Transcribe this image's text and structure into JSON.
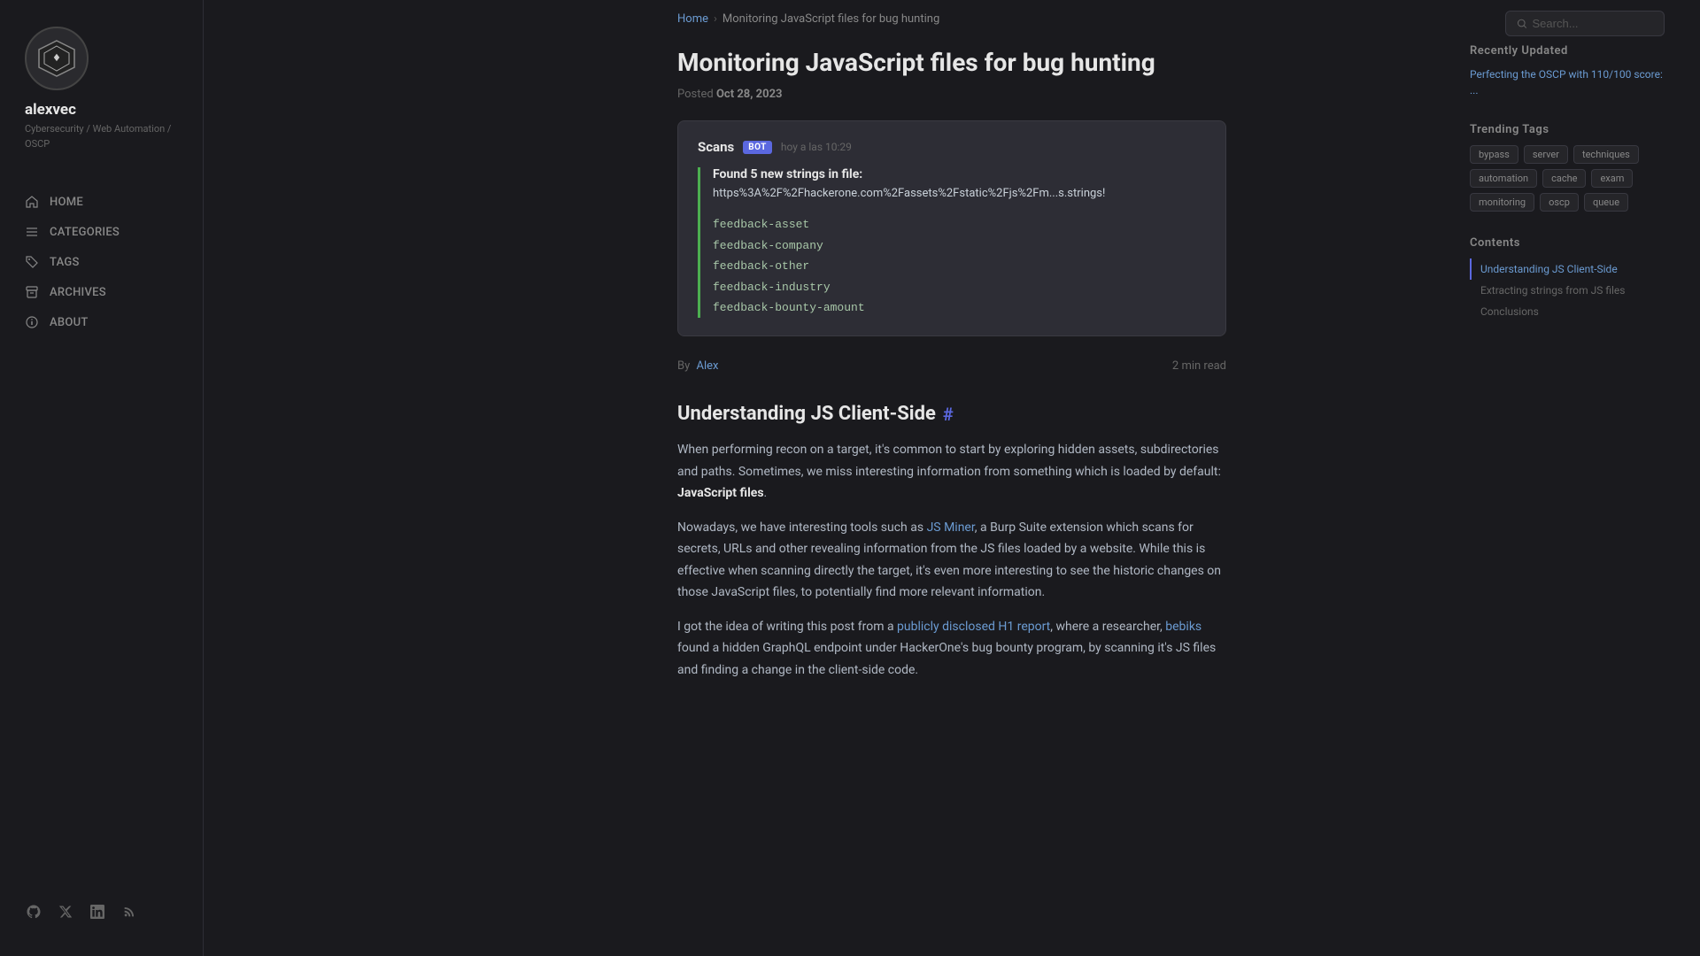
{
  "site": {
    "username": "alexvec",
    "tagline": "Cybersecurity / Web Automation / OSCP"
  },
  "nav": {
    "items": [
      {
        "id": "home",
        "label": "HOME",
        "icon": "home"
      },
      {
        "id": "categories",
        "label": "CATEGORIES",
        "icon": "menu"
      },
      {
        "id": "tags",
        "label": "TAGS",
        "icon": "tag"
      },
      {
        "id": "archives",
        "label": "ARCHIVES",
        "icon": "archive"
      },
      {
        "id": "about",
        "label": "ABOUT",
        "icon": "info"
      }
    ]
  },
  "social": {
    "items": [
      "github",
      "twitter",
      "linkedin",
      "rss"
    ]
  },
  "breadcrumb": {
    "home_label": "Home",
    "separator": "›",
    "current": "Monitoring JavaScript files for bug hunting"
  },
  "search": {
    "placeholder": "Search..."
  },
  "article": {
    "title": "Monitoring JavaScript files for bug hunting",
    "posted_label": "Posted",
    "date": "Oct 28, 2023",
    "author_prefix": "By",
    "author": "Alex",
    "read_time": "2 min read",
    "chat": {
      "sender": "Scans",
      "bot_badge": "BOT",
      "time": "hoy a las 10:29",
      "found_text": "Found 5 new strings in file:",
      "url": "https%3A%2F%2Fhackerone.com%2Fassets%2Fstatic%2Fjs%2Fm...s.strings!",
      "strings": [
        "feedback-asset",
        "feedback-company",
        "feedback-other",
        "feedback-industry",
        "feedback-bounty-amount"
      ]
    },
    "section1_title": "Understanding JS Client-Side",
    "section1_hash": "#",
    "body": [
      "When performing recon on a target, it's common to start by exploring hidden assets, subdirectories and paths. Sometimes, we miss interesting information from something which is loaded by default: JavaScript files.",
      "Nowadays, we have interesting tools such as JS Miner, a Burp Suite extension which scans for secrets, URLs and other revealing information from the JS files loaded by a website. While this is effective when scanning directly the target, it's even more interesting to see the historic changes on those JavaScript files, to potentially find more relevant information.",
      "I got the idea of writing this post from a publicly disclosed H1 report, where a researcher, bebiks found a hidden GraphQL endpoint under HackerOne's bug bounty program, by scanning it's JS files and finding a change in the client-side code."
    ],
    "body_bold_1": "JavaScript files",
    "link_jsminer": "JS Miner",
    "link_report": "publicly disclosed H1 report",
    "link_bebiks": "bebiks"
  },
  "right_sidebar": {
    "recently_updated_title": "Recently Updated",
    "recent_item": "Perfecting the OSCP with 110/100 score: ...",
    "trending_tags_title": "Trending Tags",
    "tags": [
      "bypass",
      "server",
      "techniques",
      "automation",
      "cache",
      "exam",
      "monitoring",
      "oscp",
      "queue"
    ],
    "contents_title": "Contents",
    "contents_items": [
      {
        "label": "Understanding JS Client-Side",
        "active": true
      },
      {
        "label": "Extracting strings from JS files",
        "active": false
      },
      {
        "label": "Conclusions",
        "active": false
      }
    ]
  }
}
